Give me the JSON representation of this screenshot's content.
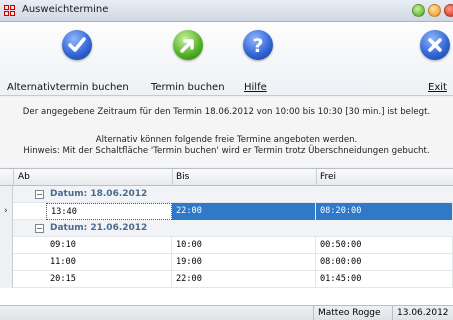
{
  "window": {
    "title": "Ausweichtermine"
  },
  "toolbar": {
    "alt_booking_label": "Alternativtermin buchen",
    "book_label": "Termin buchen",
    "help_label": "Hilfe",
    "exit_label": "Exit"
  },
  "message": {
    "line1": "Der angegebene Zeitraum für den Termin 18.06.2012 von 10:00 bis 10:30 [30 min.] ist belegt.",
    "line2": "Alternativ können folgende freie Termine angeboten werden.",
    "line3": "Hinweis: Mit der Schaltfläche 'Termin buchen' wird er Termin trotz Überschneidungen gebucht."
  },
  "grid": {
    "columns": [
      "Ab",
      "Bis",
      "Frei"
    ],
    "groups": [
      {
        "label": "Datum: 18.06.2012",
        "rows": [
          [
            "13:40",
            "22:00",
            "08:20:00"
          ]
        ]
      },
      {
        "label": "Datum: 21.06.2012",
        "rows": [
          [
            "09:10",
            "10:00",
            "00:50:00"
          ],
          [
            "11:00",
            "19:00",
            "08:00:00"
          ],
          [
            "20:15",
            "22:00",
            "01:45:00"
          ]
        ]
      }
    ],
    "selected_indicator": "›"
  },
  "status": {
    "user": "Matteo Rogge",
    "date": "13.06.2012"
  },
  "colors": {
    "selection": "#3078c8",
    "group_text": "#4a6a8f"
  },
  "icons": {
    "alt_booking": "checkmark-circle-icon",
    "book": "green-arrow-icon",
    "help": "question-mark-icon",
    "exit": "close-x-icon"
  }
}
